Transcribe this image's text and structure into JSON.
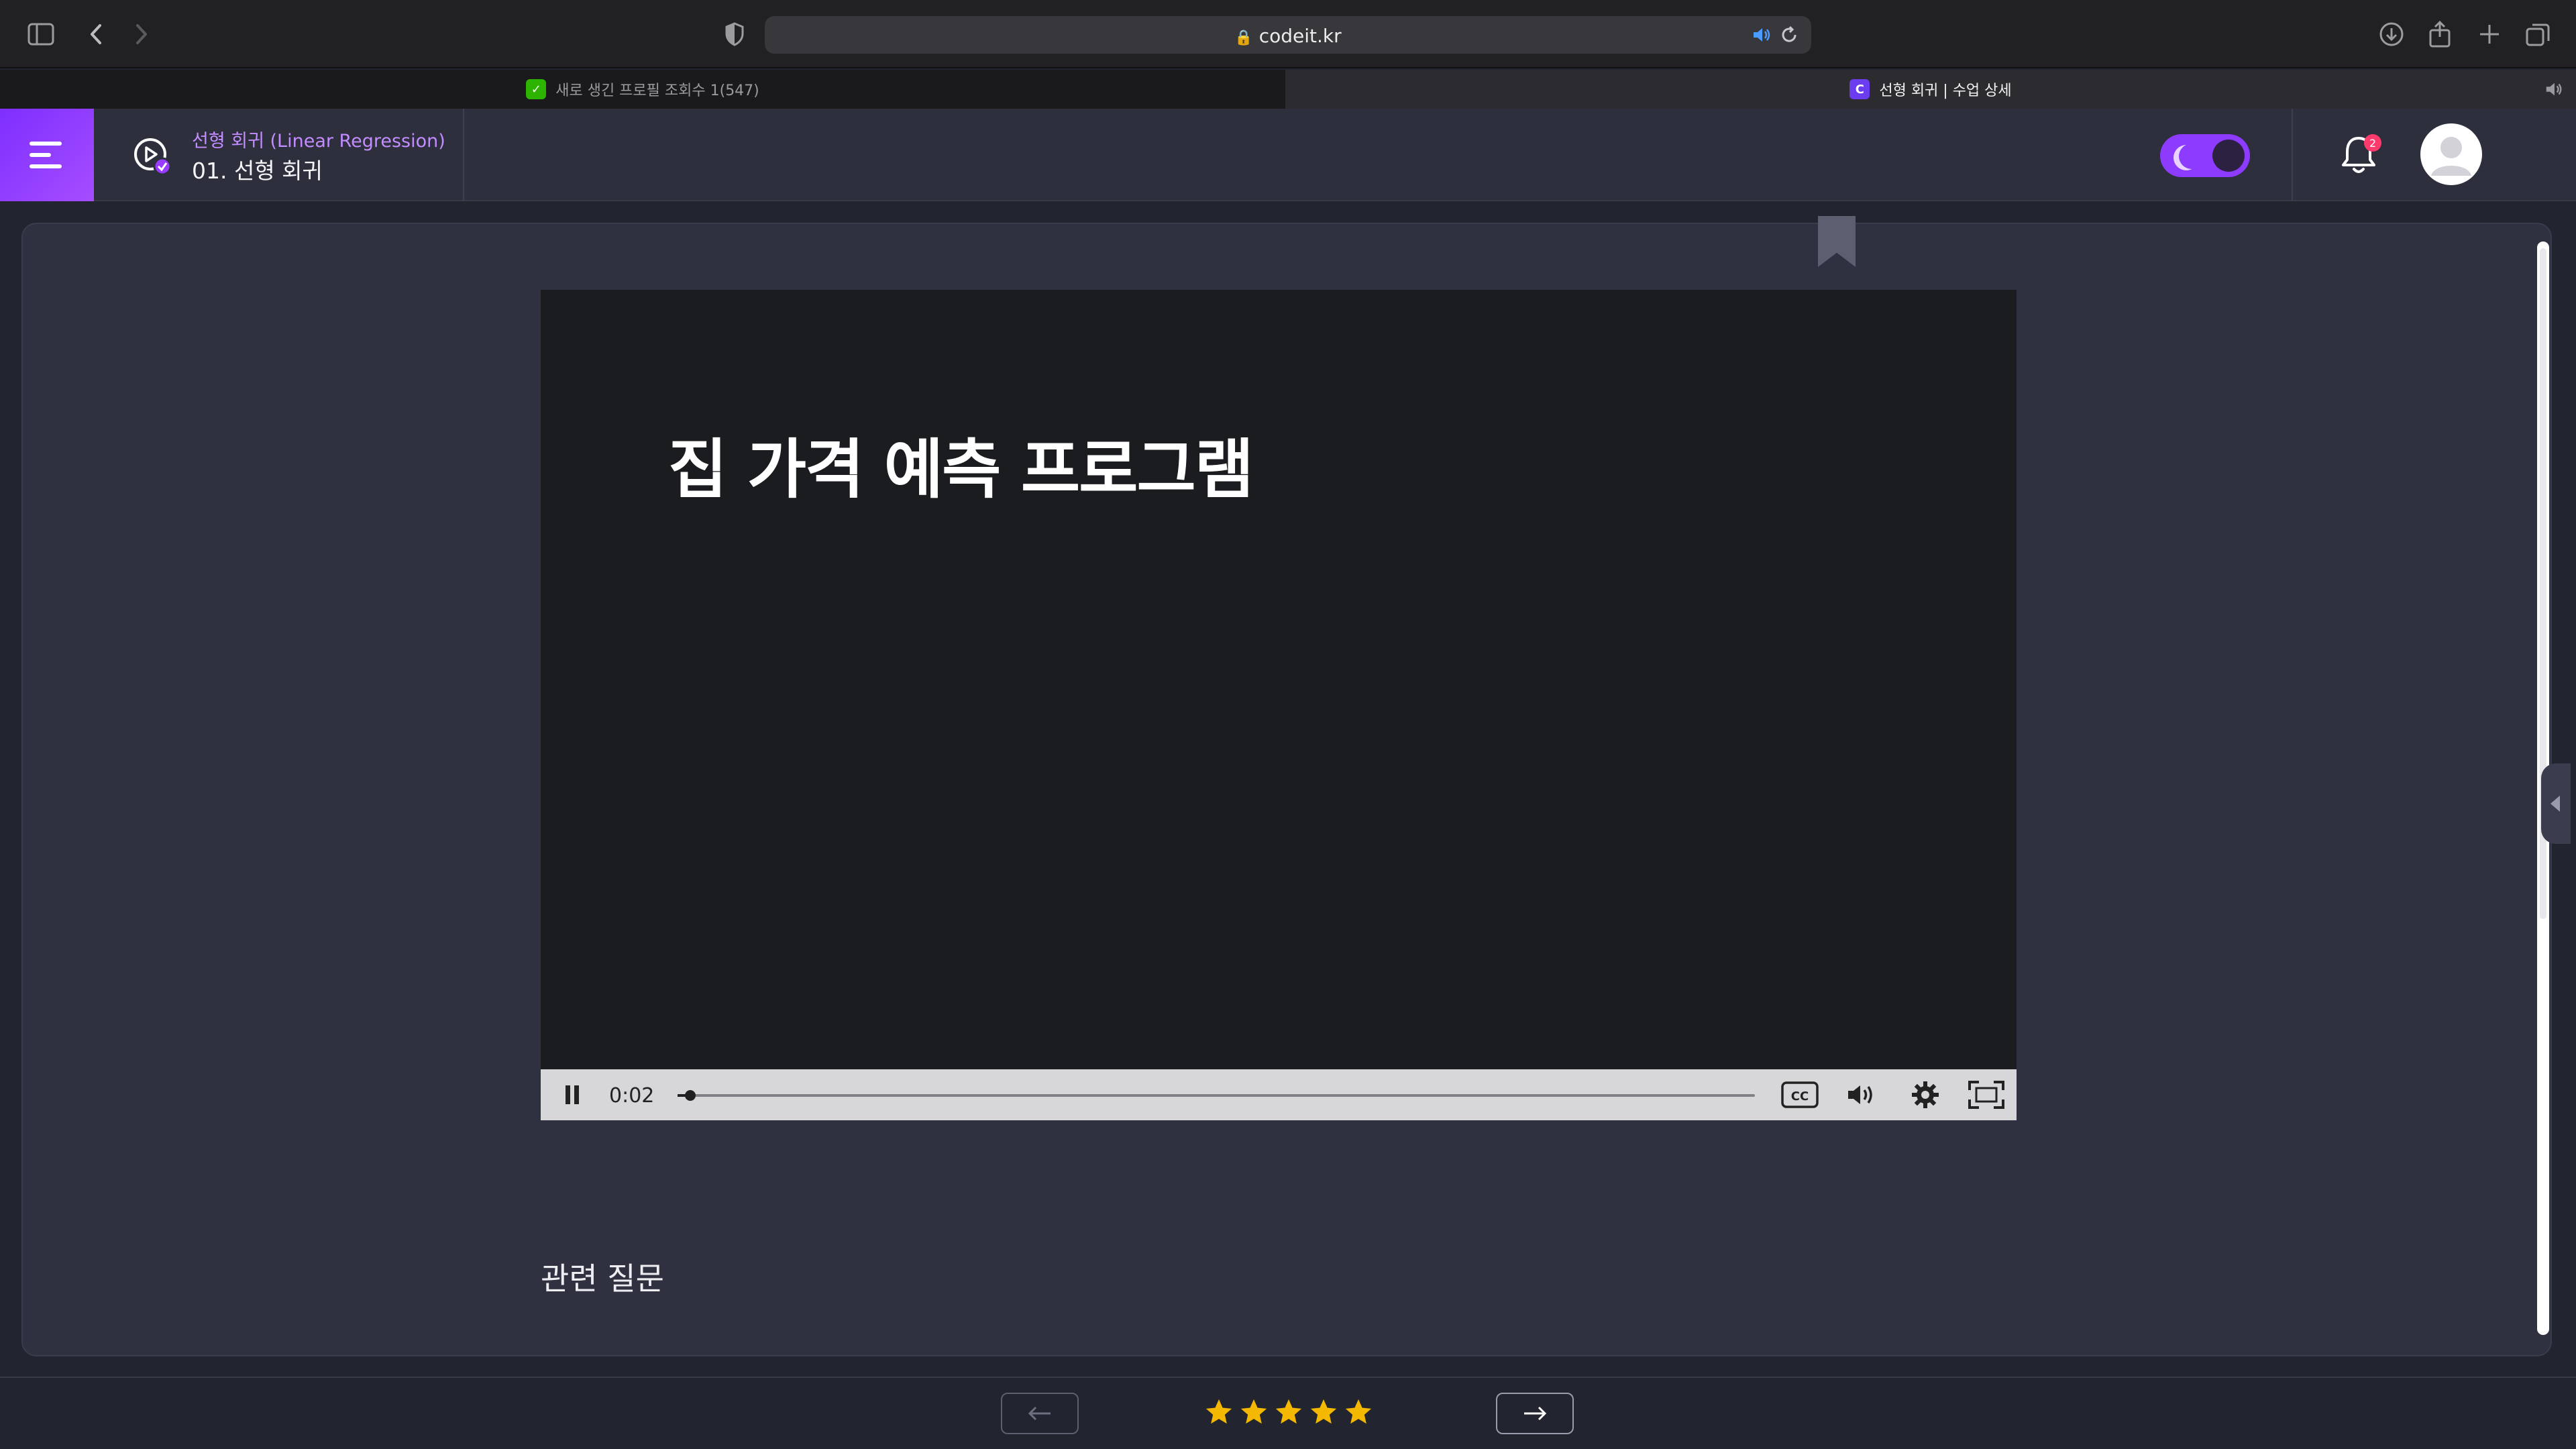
{
  "browser": {
    "url": "codeit.kr",
    "tabs": [
      {
        "title": "새로 생긴 프로필 조회수 1(547)",
        "active": false
      },
      {
        "title": "선형 회귀 | 수업 상세",
        "active": true
      }
    ]
  },
  "header": {
    "course_title": "선형 회귀 (Linear Regression)",
    "lesson_title": "01. 선형 회귀",
    "notification_count": "2",
    "dark_mode": true,
    "accent_color": "#8d3bff"
  },
  "video": {
    "slide_title": "집 가격 예측 프로그램",
    "current_time": "0:02",
    "progress_fraction": 0.012,
    "playing": true
  },
  "related": {
    "title": "관련 질문"
  },
  "footer": {
    "rating_stars": 5,
    "star_color": "#f5b800"
  }
}
